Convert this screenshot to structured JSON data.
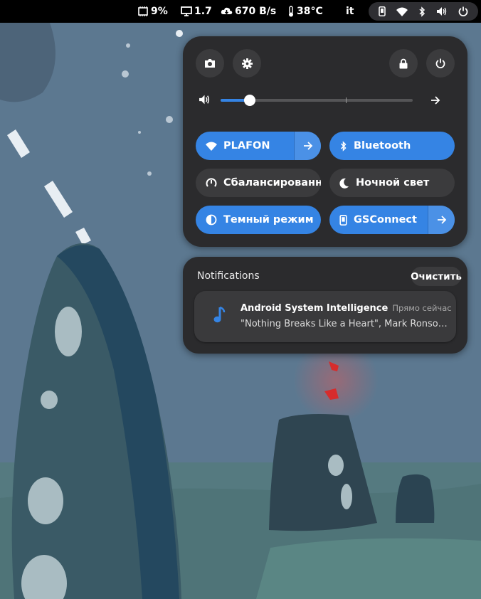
{
  "topbar": {
    "cpu": "9%",
    "load": "1.7",
    "net": "670 B/s",
    "temp": "38°C",
    "keyboard_layout": "it",
    "status_icons": [
      "phone-icon",
      "wifi-icon",
      "bluetooth-icon",
      "volume-icon",
      "power-icon"
    ]
  },
  "quick_settings": {
    "buttons": [
      "screenshot-icon",
      "settings-icon",
      "lock-icon",
      "power-icon"
    ],
    "volume": {
      "level": 0.15,
      "icon": "volume-icon"
    },
    "toggles": [
      {
        "label": "PLAFON",
        "icon": "wifi-icon",
        "active": true,
        "has_menu": true
      },
      {
        "label": "Bluetooth",
        "icon": "bluetooth-icon",
        "active": true,
        "has_menu": false
      },
      {
        "label": "Сбалансированный",
        "icon": "power-profile-icon",
        "active": false,
        "has_menu": false
      },
      {
        "label": "Ночной свет",
        "icon": "moon-icon",
        "active": false,
        "has_menu": false
      },
      {
        "label": "Темный режим",
        "icon": "dark-mode-icon",
        "active": true,
        "has_menu": false
      },
      {
        "label": "GSConnect",
        "icon": "phone-icon",
        "active": true,
        "has_menu": true
      }
    ]
  },
  "notifications": {
    "title": "Notifications",
    "clear_label": "Очистить",
    "items": [
      {
        "app": "Android System Intelligence",
        "time": "Прямо сейчас",
        "body": "\"Nothing Breaks Like a Heart\", Mark Ronson: Havana (feat. Young Thug)",
        "icon": "music-note-icon"
      }
    ]
  },
  "colors": {
    "accent": "#3584e4",
    "panel": "#2b2b2d",
    "button": "#3b3b3d",
    "topbar": "#000000"
  }
}
